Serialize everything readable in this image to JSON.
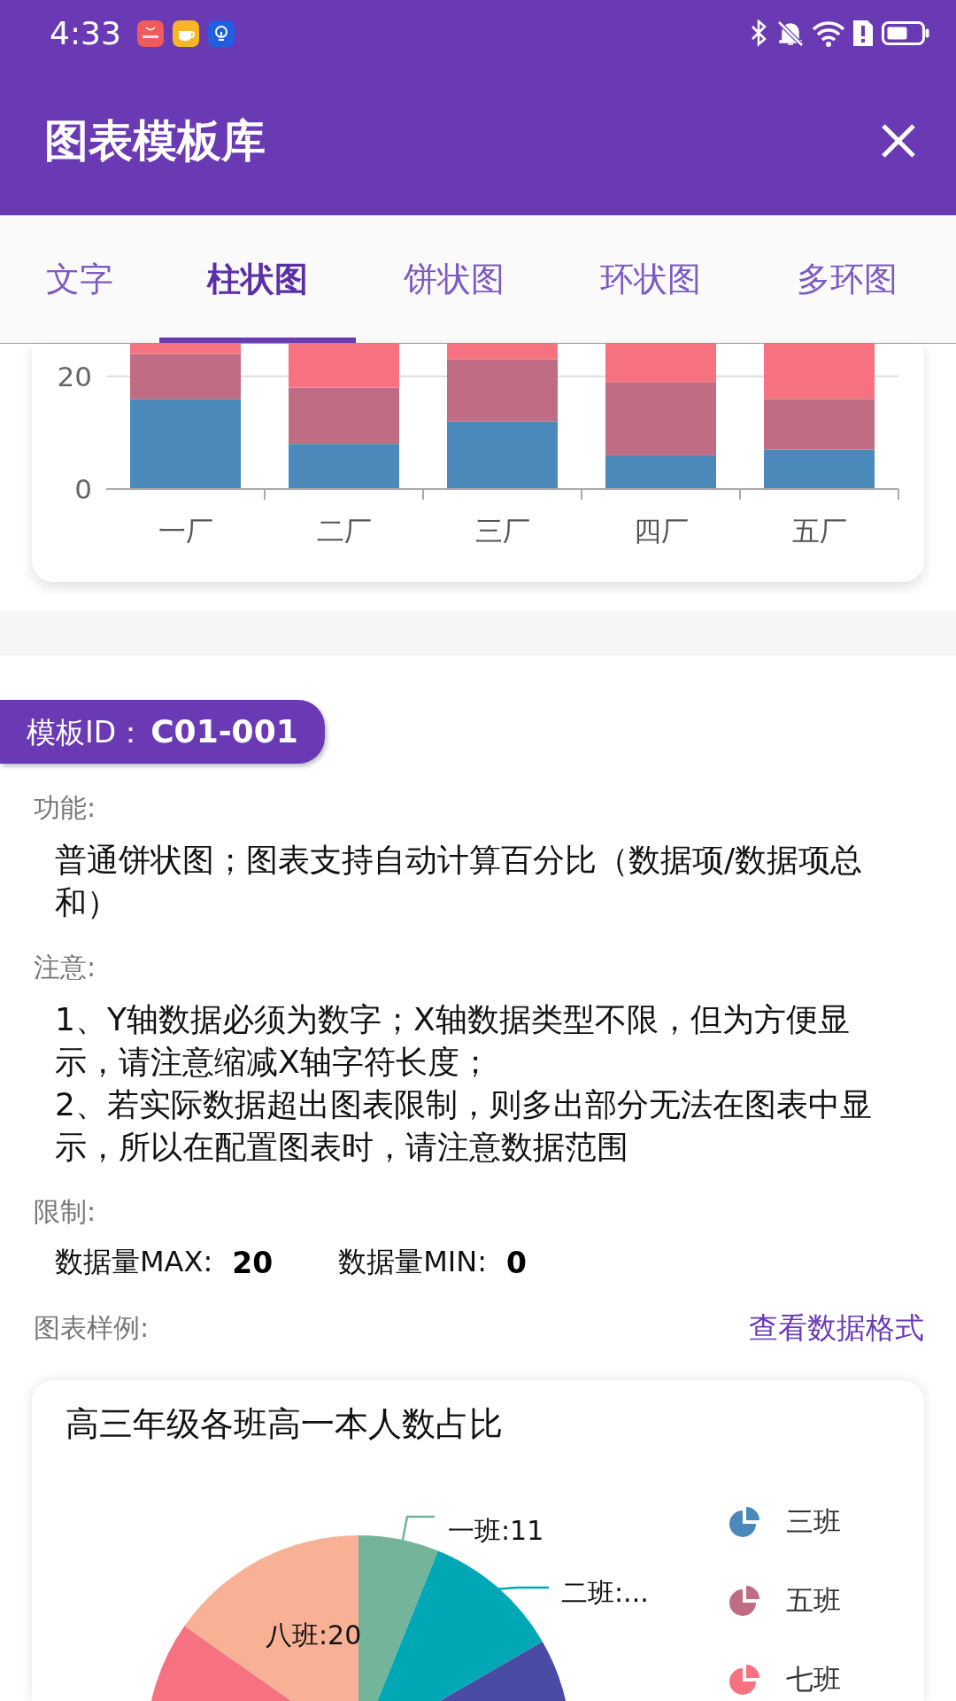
{
  "status_bar": {
    "time": "4:33"
  },
  "header": {
    "title": "图表模板库"
  },
  "tabs": [
    {
      "label": "文字",
      "selected": false
    },
    {
      "label": "柱状图",
      "selected": true
    },
    {
      "label": "饼状图",
      "selected": false
    },
    {
      "label": "环状图",
      "selected": false
    },
    {
      "label": "多环图",
      "selected": false
    }
  ],
  "bar_chart": {
    "chart_data": {
      "type": "bar",
      "stacked": true,
      "categories": [
        "一厂",
        "二厂",
        "三厂",
        "四厂",
        "五厂"
      ],
      "yticks": [
        0,
        20
      ],
      "ylim": [
        0,
        25.8
      ],
      "series": [
        {
          "color": "#4a89b9",
          "values": [
            16,
            8,
            12,
            6,
            7
          ]
        },
        {
          "color": "#c06c84",
          "values": [
            8,
            10,
            11,
            13,
            9
          ]
        },
        {
          "color": "#f67280",
          "values": [
            1.8,
            7.8,
            2.8,
            6.8,
            9.8
          ]
        }
      ]
    }
  },
  "template": {
    "id_badge": "模板ID：**C01-001**",
    "sections": [
      {
        "label": "功能:",
        "lines": [
          "普通饼状图；图表支持自动计算百分比（数据项/数据项总和）"
        ]
      },
      {
        "label": "注意:",
        "lines": [
          "1、Y轴数据必须为数字；X轴数据类型不限，但为方便显示，请注意缩减X轴字符长度；",
          "2、若实际数据超出图表限制，则多出部分无法在图表中显示，所以在配置图表时，请注意数据范围"
        ]
      }
    ],
    "limits_label": "限制:",
    "limits": [
      {
        "label": "数据量MAX:",
        "value": "20"
      },
      {
        "label": "数据量MIN:",
        "value": "0"
      }
    ],
    "sample_label": "图表样例:",
    "format_link": "查看数据格式"
  },
  "pie_card": {
    "title": "高三年级各班高一本人数占比",
    "slices": [
      {
        "label": "一班:11",
        "color": "#74b49b"
      },
      {
        "label": "二班:...",
        "color": "#00a8b5"
      },
      {
        "color": "#494ca2"
      },
      {
        "color": "#f67280"
      },
      {
        "label": "八班:20",
        "color": "#f8b195"
      }
    ],
    "legend": [
      {
        "name": "三班",
        "color": "#4a89b9"
      },
      {
        "name": "五班",
        "color": "#c06c84"
      },
      {
        "name": "七班",
        "color": "#f67280"
      }
    ]
  }
}
